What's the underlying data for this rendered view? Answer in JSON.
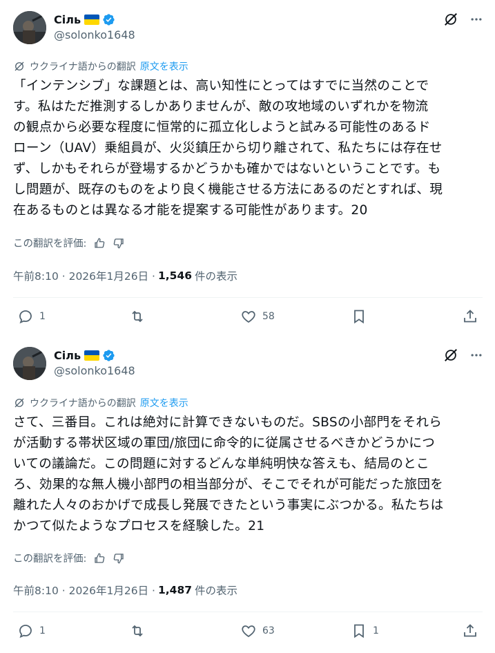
{
  "tweets": [
    {
      "author": {
        "name": "Сіль",
        "handle": "@solonko1648"
      },
      "translation": {
        "label": "ウクライナ語からの翻訳",
        "show_original": "原文を表示"
      },
      "text": "「インテンシブ」な課題とは、高い知性にとってはすでに当然のことで\nす。私はただ推測するしかありませんが、敵の攻地域のいずれかを物流\nの観点から必要な程度に恒常的に孤立化しようと試みる可能性のあるド\nローン（UAV）乗組員が、火災鎮圧から切り離されて、私たちには存在せ\nず、しかもそれらが登場するかどうかも確かではないということです。も\nし問題が、既存のものをより良く機能させる方法にあるのだとすれば、現\n在あるものとは異なる才能を提案する可能性があります。20",
      "rate_label": "この翻訳を評価:",
      "timestamp": "午前8:10 · 2026年1月26日 · ",
      "views": "1,546",
      "views_label": "件の表示",
      "stats": {
        "replies": "1",
        "reposts": "",
        "likes": "58",
        "bookmarks": ""
      }
    },
    {
      "author": {
        "name": "Сіль",
        "handle": "@solonko1648"
      },
      "translation": {
        "label": "ウクライナ語からの翻訳",
        "show_original": "原文を表示"
      },
      "text": "さて、三番目。これは絶対に計算できないものだ。SBSの小部門をそれら\nが活動する帯状区域の軍団/旅団に命令的に従属させるべきかどうかにつ\nいての議論だ。この問題に対するどんな単純明快な答えも、結局のとこ\nろ、効果的な無人機小部門の相当部分が、そこでそれが可能だった旅団を\n離れた人々のおかげで成長し発展できたという事実にぶつかる。私たちは\nかつて似たようなプロセスを経験した。21",
      "rate_label": "この翻訳を評価:",
      "timestamp": "午前8:10 · 2026年1月26日 · ",
      "views": "1,487",
      "views_label": "件の表示",
      "stats": {
        "replies": "1",
        "reposts": "",
        "likes": "63",
        "bookmarks": "1"
      }
    }
  ],
  "colors": {
    "accent": "#1d9bf0",
    "text": "#0f1419",
    "muted": "#536471",
    "divider": "#eff3f4"
  }
}
